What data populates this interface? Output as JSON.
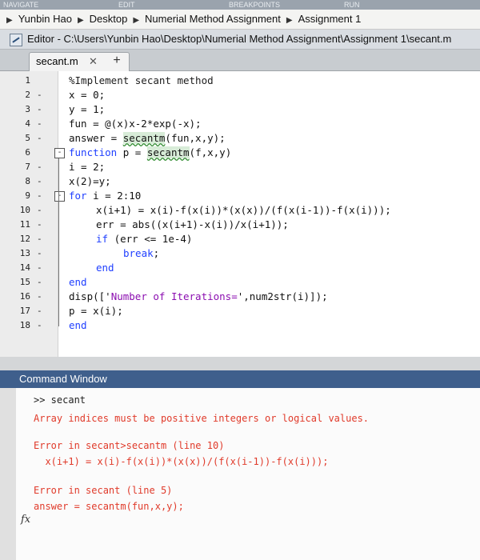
{
  "top_strip": [
    "NAVIGATE",
    "EDIT",
    "BREAKPOINTS",
    "RUN"
  ],
  "breadcrumb": [
    "Yunbin Hao",
    "Desktop",
    "Numerial Method Assignment",
    "Assignment 1"
  ],
  "editor_title": "Editor - C:\\Users\\Yunbin Hao\\Desktop\\Numerial Method Assignment\\Assignment 1\\secant.m",
  "tab": {
    "name": "secant.m",
    "close": "✕",
    "add": "+"
  },
  "code_lines": [
    {
      "n": "1",
      "bp": "",
      "fold": "",
      "indent": 0,
      "parts": [
        {
          "t": "%Implement secant method",
          "c": "cm"
        }
      ]
    },
    {
      "n": "2",
      "bp": "-",
      "fold": "",
      "indent": 0,
      "parts": [
        {
          "t": "x = 0;",
          "c": ""
        }
      ]
    },
    {
      "n": "3",
      "bp": "-",
      "fold": "",
      "indent": 0,
      "parts": [
        {
          "t": "y = 1;",
          "c": ""
        }
      ]
    },
    {
      "n": "4",
      "bp": "-",
      "fold": "",
      "indent": 0,
      "parts": [
        {
          "t": "fun = @(x)x-2*exp(-x);",
          "c": ""
        }
      ]
    },
    {
      "n": "5",
      "bp": "-",
      "fold": "",
      "indent": 0,
      "parts": [
        {
          "t": "answer = ",
          "c": ""
        },
        {
          "t": "secantm",
          "c": "hl"
        },
        {
          "t": "(fun,x,y);",
          "c": ""
        }
      ]
    },
    {
      "n": "6",
      "bp": "",
      "fold": "-",
      "indent": 0,
      "parts": [
        {
          "t": "function",
          "c": "kw"
        },
        {
          "t": " p = ",
          "c": ""
        },
        {
          "t": "secantm",
          "c": "hl"
        },
        {
          "t": "(f,x,y)",
          "c": ""
        }
      ]
    },
    {
      "n": "7",
      "bp": "-",
      "fold": "",
      "indent": 0,
      "parts": [
        {
          "t": "i = 2;",
          "c": ""
        }
      ]
    },
    {
      "n": "8",
      "bp": "-",
      "fold": "",
      "indent": 0,
      "parts": [
        {
          "t": "x(2)=y;",
          "c": ""
        }
      ]
    },
    {
      "n": "9",
      "bp": "-",
      "fold": "-",
      "indent": 0,
      "parts": [
        {
          "t": "for",
          "c": "kw"
        },
        {
          "t": " i = 2:10",
          "c": ""
        }
      ]
    },
    {
      "n": "10",
      "bp": "-",
      "fold": "",
      "indent": 1,
      "parts": [
        {
          "t": "x(i+1) = x(i)-f(x(i))*(x(x))/(f(x(i-1))-f(x(i)));",
          "c": ""
        }
      ]
    },
    {
      "n": "11",
      "bp": "-",
      "fold": "",
      "indent": 1,
      "parts": [
        {
          "t": "err = abs((x(i+1)-x(i))/x(i+1));",
          "c": ""
        }
      ]
    },
    {
      "n": "12",
      "bp": "-",
      "fold": "",
      "indent": 1,
      "parts": [
        {
          "t": "if",
          "c": "kw"
        },
        {
          "t": " (err <= 1e-4)",
          "c": ""
        }
      ]
    },
    {
      "n": "13",
      "bp": "-",
      "fold": "",
      "indent": 2,
      "parts": [
        {
          "t": "break",
          "c": "kw"
        },
        {
          "t": ";",
          "c": ""
        }
      ]
    },
    {
      "n": "14",
      "bp": "-",
      "fold": "",
      "indent": 1,
      "parts": [
        {
          "t": "end",
          "c": "kw"
        }
      ]
    },
    {
      "n": "15",
      "bp": "-",
      "fold": "",
      "indent": 0,
      "parts": [
        {
          "t": "end",
          "c": "kw"
        }
      ]
    },
    {
      "n": "16",
      "bp": "-",
      "fold": "",
      "indent": 0,
      "parts": [
        {
          "t": "disp(['",
          "c": ""
        },
        {
          "t": "Number of Iterations=",
          "c": "str"
        },
        {
          "t": "',num2str(i)]);",
          "c": ""
        }
      ]
    },
    {
      "n": "17",
      "bp": "-",
      "fold": "",
      "indent": 0,
      "parts": [
        {
          "t": "p = x(i);",
          "c": ""
        }
      ]
    },
    {
      "n": "18",
      "bp": "-",
      "fold": "",
      "indent": 0,
      "parts": [
        {
          "t": "end",
          "c": "kw"
        }
      ]
    }
  ],
  "command_window": {
    "title": "Command Window",
    "lines": [
      {
        "t": ">> secant",
        "c": "prompt"
      },
      {
        "t": "Array indices must be positive integers or logical values.",
        "c": "err"
      },
      {
        "t": "",
        "c": ""
      },
      {
        "t": "Error in secant>secantm (line 10)",
        "c": "err"
      },
      {
        "t": "  x(i+1) = x(i)-f(x(i))*(x(x))/(f(x(i-1))-f(x(i)));",
        "c": "err"
      },
      {
        "t": "",
        "c": ""
      },
      {
        "t": "Error in secant (line 5)",
        "c": "err"
      },
      {
        "t": "answer = secantm(fun,x,y);",
        "c": "err"
      }
    ],
    "fx": "fx"
  }
}
